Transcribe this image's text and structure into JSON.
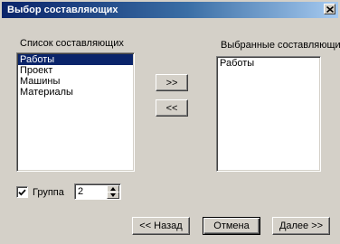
{
  "dialog": {
    "title": "Выбор составляющих"
  },
  "left_list": {
    "label": "Список составляющих",
    "items": [
      "Работы",
      "Проект",
      "Машины",
      "Материалы"
    ],
    "selected_index": 0
  },
  "right_list": {
    "label": "Выбранные составляющие",
    "items": [
      "Работы"
    ]
  },
  "transfer": {
    "add_label": ">>",
    "remove_label": "<<"
  },
  "group": {
    "label": "Группа",
    "checked": true,
    "value": "2"
  },
  "buttons": {
    "back": "<< Назад",
    "cancel": "Отмена",
    "next": "Далее >>"
  },
  "icons": {
    "close": "close-icon",
    "check": "check-icon",
    "spin_up": "arrow-up-icon",
    "spin_down": "arrow-down-icon"
  },
  "colors": {
    "title_start": "#0a246a",
    "title_end": "#a6caf0",
    "selection": "#0a246a",
    "face": "#d4d0c8"
  }
}
